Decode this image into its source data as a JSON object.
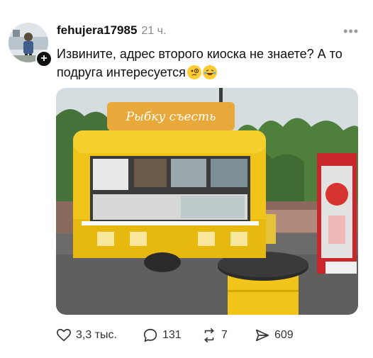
{
  "post": {
    "username": "fehujera17985",
    "time": "21 ч.",
    "text": "Извините, адрес второго киоска не знаете? А то подруга интересуется",
    "emojis": [
      "face-with-monocle-icon",
      "laughing-face-icon"
    ],
    "photo": {
      "sign_text": "Рыбку съесть",
      "colors": {
        "kiosk": "#f0c419",
        "sign": "#e9a93a",
        "sky": "#cfd6db",
        "trees": "#4f7f3c",
        "asphalt": "#5f5f5f",
        "booth": "#c8262a"
      }
    }
  },
  "actions": {
    "likes": "3,3 тыс.",
    "comments": "131",
    "reposts": "7",
    "shares": "609"
  }
}
